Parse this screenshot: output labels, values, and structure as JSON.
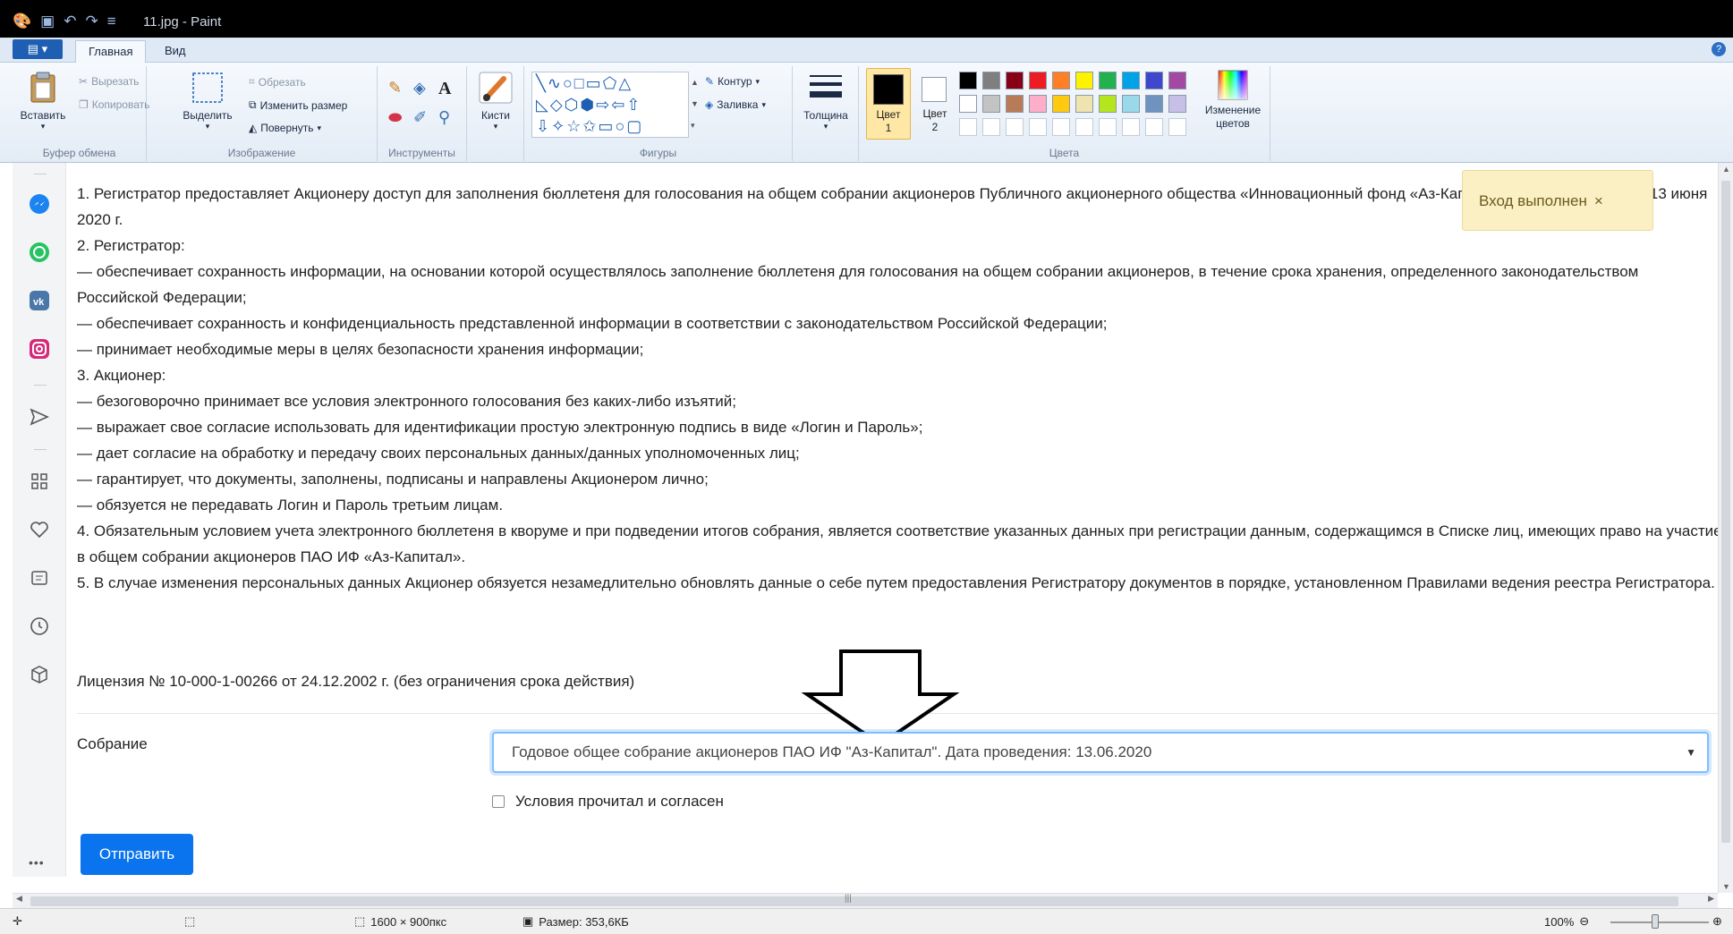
{
  "window": {
    "title": "11.jpg - Paint"
  },
  "ribbon_tabs": [
    {
      "label": "Главная"
    },
    {
      "label": "Вид"
    }
  ],
  "ribbon": {
    "clipboard": {
      "paste": "Вставить",
      "cut": "Вырезать",
      "copy": "Копировать",
      "group": "Буфер обмена"
    },
    "image": {
      "select": "Выделить",
      "crop": "Обрезать",
      "resize": "Изменить размер",
      "rotate": "Повернуть",
      "group": "Изображение"
    },
    "tools": {
      "group": "Инструменты"
    },
    "brushes": {
      "label": "Кисти"
    },
    "shapes": {
      "outline": "Контур",
      "fill": "Заливка",
      "group": "Фигуры"
    },
    "size": {
      "label": "Толщина"
    },
    "colors": {
      "color1": "Цвет",
      "color1_num": "1",
      "color2": "Цвет",
      "color2_num": "2",
      "edit_line1": "Изменение",
      "edit_line2": "цветов",
      "group": "Цвета",
      "palette_row1": [
        "#000000",
        "#7f7f7f",
        "#880015",
        "#ed1c24",
        "#ff7f27",
        "#fff200",
        "#22b14c",
        "#00a2e8",
        "#3f48cc",
        "#a349a4"
      ],
      "palette_row2": [
        "#ffffff",
        "#c3c3c3",
        "#b97a57",
        "#ffaec9",
        "#ffc90e",
        "#efe4b0",
        "#b5e61d",
        "#99d9ea",
        "#7092be",
        "#c8bfe7"
      ]
    }
  },
  "document": {
    "paragraphs": [
      "1. Регистратор предоставляет Акционеру доступ для заполнения бюллетеня для голосования на общем собрании акционеров Публичного акционерного общества «Инновационный фонд «Аз-Капитал», которое состоится 13 июня 2020 г.",
      "2. Регистратор:",
      "— обеспечивает сохранность информации, на основании которой осуществлялось заполнение бюллетеня для голосования на общем собрании акционеров, в течение срока хранения, определенного законодательством Российской Федерации;",
      "— обеспечивает сохранность и конфиденциальность представленной информации в соответствии с законодательством Российской Федерации;",
      "— принимает необходимые меры в целях безопасности хранения информации;",
      "3. Акционер:",
      "— безоговорочно принимает все условия электронного голосования без каких-либо изъятий;",
      "— выражает свое согласие использовать для идентификации простую электронную подпись в виде «Логин и Пароль»;",
      "— дает согласие на обработку и передачу своих персональных данных/данных уполномоченных лиц;",
      "— гарантирует, что документы, заполнены, подписаны и направлены Акционером лично;",
      "— обязуется не передавать Логин и Пароль третьим лицам.",
      "4. Обязательным условием учета электронного бюллетеня в кворуме и при подведении итогов собрания, является соответствие указанных данных при регистрации данным, содержащимся в Списке лиц, имеющих право на участие в общем собрании акционеров ПАО ИФ «Аз-Капитал».",
      "5. В случае изменения персональных данных Акционер обязуется незамедлительно обновлять данные о себе путем предоставления Регистратору документов в порядке, установленном Правилами ведения реестра Регистратора."
    ],
    "license": "Лицензия № 10-000-1-00266 от 24.12.2002 г. (без ограничения срока действия)"
  },
  "toast": {
    "text": "Вход выполнен",
    "close": "×"
  },
  "form": {
    "meeting_label": "Собрание",
    "meeting_value": "Годовое общее собрание акционеров ПАО ИФ \"Аз-Капитал\". Дата проведения: 13.06.2020",
    "agree_label": "Условия прочитал и согласен",
    "submit_label": "Отправить"
  },
  "left_sidebar": {
    "more": "•••"
  },
  "statusbar": {
    "dimensions": "1600 × 900пкс",
    "size": "Размер: 353,6КБ",
    "zoom": "100%"
  }
}
